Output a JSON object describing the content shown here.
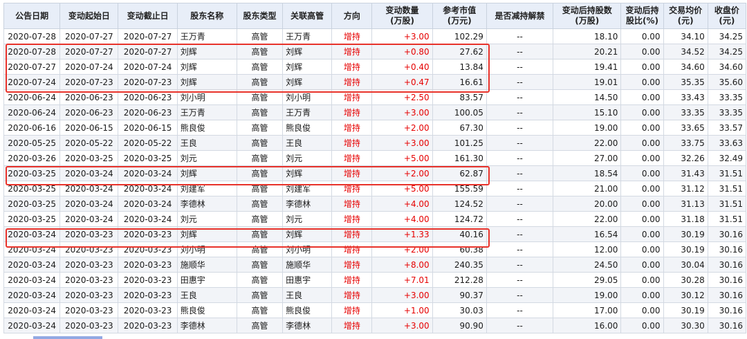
{
  "columns": [
    "公告日期",
    "变动起始日",
    "变动截止日",
    "股东名称",
    "股东类型",
    "关联高管",
    "方向",
    "变动数量\n(万股)",
    "参考市值\n(万元)",
    "是否减持解禁",
    "变动后持股数\n(万股)",
    "变动后持\n股比(%)",
    "交易均价\n(元)",
    "收盘价\n(元)"
  ],
  "rows": [
    [
      "2020-07-28",
      "2020-07-27",
      "2020-07-27",
      "王万青",
      "高管",
      "王万青",
      "增持",
      "+3.00",
      "102.29",
      "--",
      "18.10",
      "0.00",
      "34.10",
      "34.25"
    ],
    [
      "2020-07-28",
      "2020-07-27",
      "2020-07-27",
      "刘辉",
      "高管",
      "刘辉",
      "增持",
      "+0.80",
      "27.62",
      "--",
      "20.21",
      "0.00",
      "34.52",
      "34.25"
    ],
    [
      "2020-07-27",
      "2020-07-24",
      "2020-07-24",
      "刘辉",
      "高管",
      "刘辉",
      "增持",
      "+0.40",
      "13.84",
      "--",
      "19.41",
      "0.00",
      "34.60",
      "34.60"
    ],
    [
      "2020-07-24",
      "2020-07-23",
      "2020-07-23",
      "刘辉",
      "高管",
      "刘辉",
      "增持",
      "+0.47",
      "16.61",
      "--",
      "19.01",
      "0.00",
      "35.35",
      "35.60"
    ],
    [
      "2020-06-24",
      "2020-06-23",
      "2020-06-23",
      "刘小明",
      "高管",
      "刘小明",
      "增持",
      "+2.50",
      "83.57",
      "--",
      "14.50",
      "0.00",
      "33.43",
      "33.35"
    ],
    [
      "2020-06-24",
      "2020-06-23",
      "2020-06-23",
      "王万青",
      "高管",
      "王万青",
      "增持",
      "+3.00",
      "100.05",
      "--",
      "15.10",
      "0.00",
      "33.35",
      "33.35"
    ],
    [
      "2020-06-16",
      "2020-06-15",
      "2020-06-15",
      "熊良俊",
      "高管",
      "熊良俊",
      "增持",
      "+2.00",
      "67.30",
      "--",
      "19.00",
      "0.00",
      "33.65",
      "33.57"
    ],
    [
      "2020-05-25",
      "2020-05-22",
      "2020-05-22",
      "王良",
      "高管",
      "王良",
      "增持",
      "+3.00",
      "101.25",
      "--",
      "22.00",
      "0.00",
      "33.75",
      "33.63"
    ],
    [
      "2020-03-26",
      "2020-03-25",
      "2020-03-25",
      "刘元",
      "高管",
      "刘元",
      "增持",
      "+5.00",
      "161.30",
      "--",
      "27.00",
      "0.00",
      "32.26",
      "32.49"
    ],
    [
      "2020-03-25",
      "2020-03-24",
      "2020-03-24",
      "刘辉",
      "高管",
      "刘辉",
      "增持",
      "+2.00",
      "62.87",
      "--",
      "18.54",
      "0.00",
      "31.43",
      "31.51"
    ],
    [
      "2020-03-25",
      "2020-03-24",
      "2020-03-24",
      "刘建军",
      "高管",
      "刘建军",
      "增持",
      "+5.00",
      "155.59",
      "--",
      "21.00",
      "0.00",
      "31.12",
      "31.51"
    ],
    [
      "2020-03-25",
      "2020-03-24",
      "2020-03-24",
      "李德林",
      "高管",
      "李德林",
      "增持",
      "+4.00",
      "124.52",
      "--",
      "20.00",
      "0.00",
      "31.13",
      "31.51"
    ],
    [
      "2020-03-25",
      "2020-03-24",
      "2020-03-24",
      "刘元",
      "高管",
      "刘元",
      "增持",
      "+4.00",
      "124.72",
      "--",
      "22.00",
      "0.00",
      "31.18",
      "31.51"
    ],
    [
      "2020-03-24",
      "2020-03-23",
      "2020-03-23",
      "刘辉",
      "高管",
      "刘辉",
      "增持",
      "+1.33",
      "40.16",
      "--",
      "16.54",
      "0.00",
      "30.19",
      "30.16"
    ],
    [
      "2020-03-24",
      "2020-03-23",
      "2020-03-23",
      "刘小明",
      "高管",
      "刘小明",
      "增持",
      "+2.00",
      "60.38",
      "--",
      "12.00",
      "0.00",
      "30.19",
      "30.16"
    ],
    [
      "2020-03-24",
      "2020-03-23",
      "2020-03-23",
      "施顺华",
      "高管",
      "施顺华",
      "增持",
      "+8.00",
      "240.35",
      "--",
      "24.50",
      "0.00",
      "30.04",
      "30.16"
    ],
    [
      "2020-03-24",
      "2020-03-23",
      "2020-03-23",
      "田惠宇",
      "高管",
      "田惠宇",
      "增持",
      "+7.01",
      "212.28",
      "--",
      "29.05",
      "0.00",
      "30.28",
      "30.16"
    ],
    [
      "2020-03-24",
      "2020-03-23",
      "2020-03-23",
      "王良",
      "高管",
      "王良",
      "增持",
      "+3.00",
      "90.37",
      "--",
      "19.00",
      "0.00",
      "30.12",
      "30.16"
    ],
    [
      "2020-03-24",
      "2020-03-23",
      "2020-03-23",
      "熊良俊",
      "高管",
      "熊良俊",
      "增持",
      "+1.00",
      "30.03",
      "--",
      "17.00",
      "0.00",
      "30.19",
      "30.16"
    ],
    [
      "2020-03-24",
      "2020-03-23",
      "2020-03-23",
      "李德林",
      "高管",
      "李德林",
      "增持",
      "+3.00",
      "90.90",
      "--",
      "16.00",
      "0.00",
      "30.30",
      "30.16"
    ]
  ],
  "highlight_color": "#e8322a",
  "increase_color": "#e60000"
}
